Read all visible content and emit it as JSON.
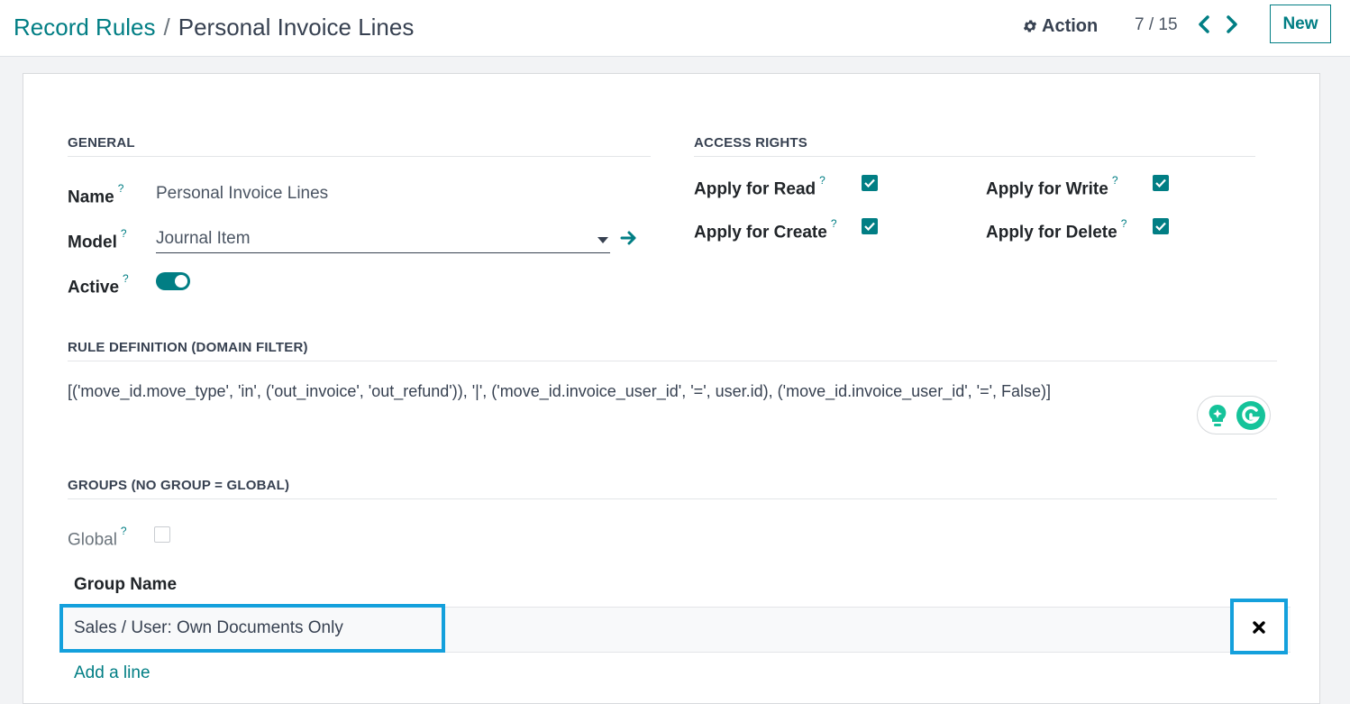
{
  "breadcrumb": {
    "parent": "Record Rules",
    "separator": "/",
    "current": "Personal Invoice Lines"
  },
  "toolbar": {
    "action_label": "Action",
    "action_icon": "gear-icon",
    "pager": "7 / 15",
    "new_label": "New"
  },
  "general": {
    "title": "GENERAL",
    "name_label": "Name",
    "name_value": "Personal Invoice Lines",
    "model_label": "Model",
    "model_value": "Journal Item",
    "active_label": "Active",
    "active": true,
    "help_mark": "?"
  },
  "access_rights": {
    "title": "ACCESS RIGHTS",
    "read_label": "Apply for Read",
    "write_label": "Apply for Write",
    "create_label": "Apply for Create",
    "delete_label": "Apply for Delete",
    "read": true,
    "write": true,
    "create": true,
    "delete": true
  },
  "rule_definition": {
    "title": "RULE DEFINITION (DOMAIN FILTER)",
    "domain": "[('move_id.move_type', 'in', ('out_invoice', 'out_refund')), '|', ('move_id.invoice_user_id', '=', user.id), ('move_id.invoice_user_id', '=', False)]"
  },
  "groups": {
    "title": "GROUPS (NO GROUP = GLOBAL)",
    "global_label": "Global",
    "global": false,
    "column_header": "Group Name",
    "rows": [
      {
        "name": "Sales / User: Own Documents Only"
      }
    ],
    "add_line_label": "Add a line"
  },
  "colors": {
    "primary": "#017e84",
    "highlight": "#14a0dc",
    "grammarly_green": "#15c39a"
  }
}
